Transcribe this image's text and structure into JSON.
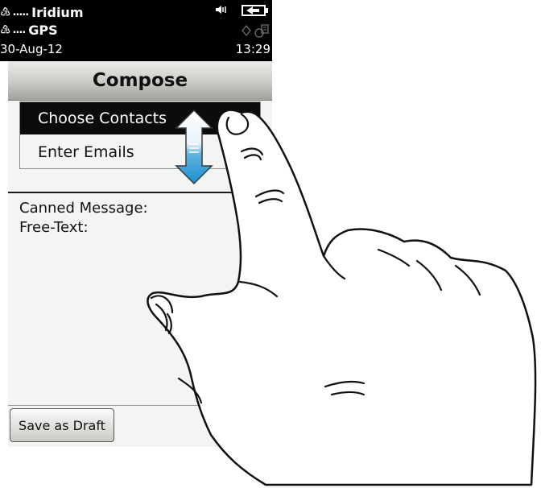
{
  "status_bar": {
    "iridium_label": "Iridium",
    "gps_label": "GPS",
    "date": "30-Aug-12",
    "time": "13:29",
    "icons": [
      "satellite-icon",
      "speaker-icon",
      "battery-icon",
      "gps-status-icon"
    ]
  },
  "header": {
    "title": "Compose"
  },
  "recipient_menu": {
    "items": [
      {
        "label": "Choose Contacts",
        "selected": true
      },
      {
        "label": "Enter Emails",
        "selected": false
      }
    ]
  },
  "form": {
    "canned_message_label": "Canned Message:",
    "free_text_label": "Free-Text:"
  },
  "footer": {
    "save_draft_label": "Save as Draft"
  },
  "overlay": {
    "gesture": "swipe-up-down",
    "arrow_color_top": "#ffffff",
    "arrow_color_bottom": "#1a8fd0"
  }
}
